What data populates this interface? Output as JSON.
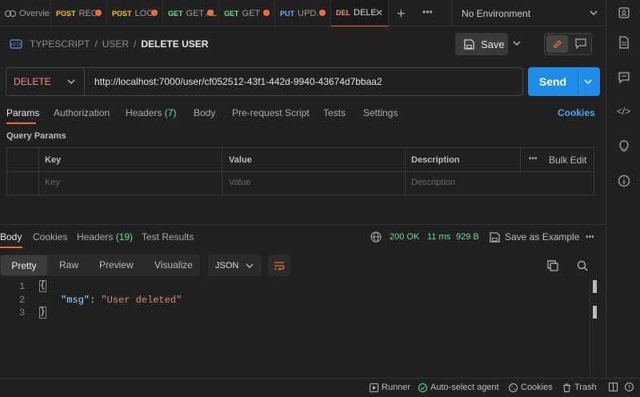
{
  "tabs": [
    {
      "method": "",
      "label": "Overvie",
      "dot": false
    },
    {
      "method": "POST",
      "label": "REC",
      "dot": true,
      "color": "#f5c518"
    },
    {
      "method": "POST",
      "label": "LOC",
      "dot": true,
      "color": "#f5c518"
    },
    {
      "method": "GET",
      "label": "GET AL",
      "dot": true,
      "color": "#6bdd9a"
    },
    {
      "method": "GET",
      "label": "GET",
      "dot": true,
      "color": "#6bdd9a"
    },
    {
      "method": "PUT",
      "label": "UPD.",
      "dot": true,
      "color": "#74aef6"
    },
    {
      "method": "DEL",
      "label": "DELE",
      "dot": false,
      "color": "#f78b8b",
      "active": true
    }
  ],
  "environment": "No Environment",
  "breadcrumb": {
    "a": "TYPESCRIPT",
    "b": "USER",
    "current": "DELETE USER",
    "sep": "/"
  },
  "save_label": "Save",
  "request": {
    "method": "DELETE",
    "url": "http://localhost:7000/user/cf052512-43f1-442d-9940-43674d7bbaa2",
    "send": "Send"
  },
  "req_tabs": {
    "params": "Params",
    "authorization": "Authorization",
    "headers": "Headers",
    "headers_count": "(7)",
    "body": "Body",
    "prerequest": "Pre-request Script",
    "tests": "Tests",
    "settings": "Settings",
    "cookies": "Cookies"
  },
  "query": {
    "title": "Query Params",
    "cols": [
      "Key",
      "Value",
      "Description"
    ],
    "bulk": "Bulk Edit",
    "placeholders": [
      "Key",
      "Value",
      "Description"
    ]
  },
  "resp_tabs": {
    "body": "Body",
    "cookies": "Cookies",
    "headers": "Headers",
    "headers_count": "(19)",
    "tests": "Test Results"
  },
  "status": {
    "code": "200 OK",
    "time": "11 ms",
    "size": "929 B",
    "save_example": "Save as Example"
  },
  "format": {
    "pretty": "Pretty",
    "raw": "Raw",
    "preview": "Preview",
    "visualize": "Visualize",
    "type": "JSON"
  },
  "code": {
    "lines": [
      "1",
      "2",
      "3"
    ],
    "open": "{",
    "key": "\"msg\"",
    "colon": ":",
    "value": "\"User deleted\"",
    "close": "}"
  },
  "footer": {
    "runner": "Runner",
    "agent": "Auto-select agent",
    "cookies": "Cookies",
    "trash": "Trash"
  },
  "colors": {
    "accent": "#f26b3a",
    "send": "#1f8ce6",
    "ok": "#6bdd9a",
    "delete": "#f78b8b"
  }
}
